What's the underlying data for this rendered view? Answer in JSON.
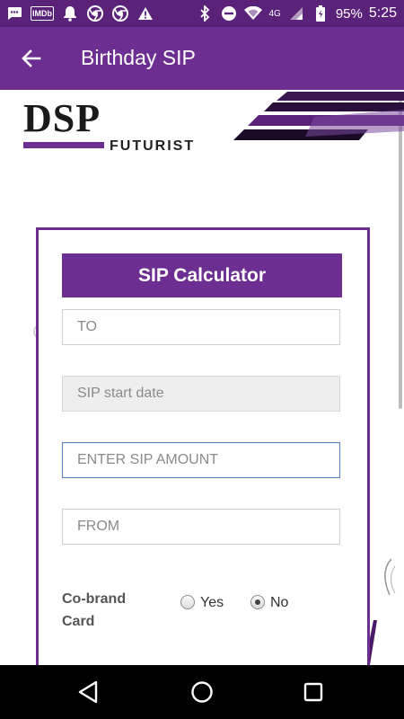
{
  "status_bar": {
    "battery": "95%",
    "time": "5:25",
    "network": "4G",
    "imdb_label": "IMDb",
    "icons": [
      "message-icon",
      "imdb-icon",
      "notification-bell-icon",
      "chrome-icon",
      "chrome-icon",
      "warning-icon",
      "bluetooth-icon",
      "do-not-disturb-icon",
      "wifi-icon",
      "signal-icon",
      "battery-icon"
    ]
  },
  "app_bar": {
    "title": "Birthday SIP",
    "back_icon": "arrow-back-icon"
  },
  "logo": {
    "main": "DSP",
    "sub": "FUTURIST"
  },
  "calculator": {
    "header": "SIP Calculator",
    "to_placeholder": "TO",
    "start_date_placeholder": "SIP start date",
    "amount_placeholder": "ENTER SIP AMOUNT",
    "from_placeholder": "FROM",
    "cobrand": {
      "label": "Co-brand Card",
      "options": [
        {
          "label": "Yes",
          "checked": false
        },
        {
          "label": "No",
          "checked": true
        }
      ]
    }
  },
  "colors": {
    "status_bar": "#5a2279",
    "app_bar": "#6d2e91",
    "accent": "#6d2e91",
    "focus_border": "#4f7fbf",
    "nav_bar": "#000000"
  },
  "nav_bar": {
    "icons": [
      "back-triangle-icon",
      "home-circle-icon",
      "recents-square-icon"
    ]
  }
}
